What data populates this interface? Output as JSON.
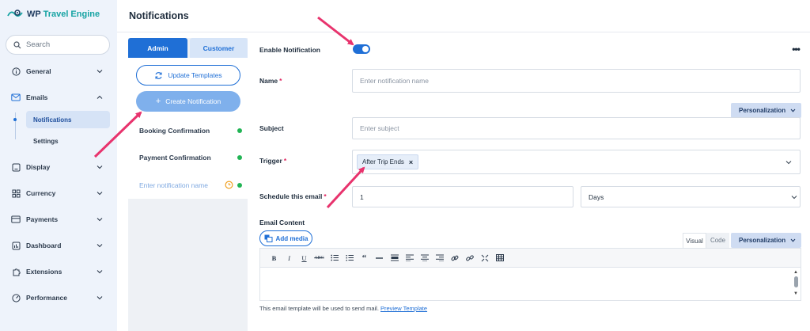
{
  "app": {
    "logo_main": "WP ",
    "logo_accent": "Travel Engine"
  },
  "search": {
    "placeholder": "Search"
  },
  "sidebar": {
    "items": [
      {
        "label": "General",
        "icon": "info-circle-icon"
      },
      {
        "label": "Emails",
        "icon": "envelope-icon"
      },
      {
        "label": "Display",
        "icon": "display-icon"
      },
      {
        "label": "Currency",
        "icon": "grid-icon"
      },
      {
        "label": "Payments",
        "icon": "card-icon"
      },
      {
        "label": "Dashboard",
        "icon": "dashboard-icon"
      },
      {
        "label": "Extensions",
        "icon": "puzzle-icon"
      },
      {
        "label": "Performance",
        "icon": "gauge-icon"
      }
    ],
    "sub_items": [
      {
        "label": "Notifications",
        "active": true
      },
      {
        "label": "Settings",
        "active": false
      }
    ]
  },
  "header": {
    "title": "Notifications"
  },
  "mid": {
    "tabs": [
      {
        "label": "Admin",
        "active": true
      },
      {
        "label": "Customer",
        "active": false
      }
    ],
    "update_label": "Update Templates",
    "create_label": "Create Notification",
    "list": [
      {
        "label": "Booking Confirmation",
        "status": "active"
      },
      {
        "label": "Payment Confirmation",
        "status": "active"
      },
      {
        "label": "Enter notification name",
        "status": "draft"
      }
    ]
  },
  "form": {
    "enable_label": "Enable Notification",
    "enable_value": true,
    "name_label": "Name",
    "name_placeholder": "Enter notification name",
    "personalization_label": "Personalization",
    "subject_label": "Subject",
    "subject_placeholder": "Enter subject",
    "trigger_label": "Trigger",
    "trigger_chip": "After Trip Ends",
    "schedule_label": "Schedule this email",
    "schedule_value": "1",
    "schedule_unit": "Days",
    "content_label": "Email Content",
    "add_media_label": "Add media",
    "editor_tabs": {
      "visual": "Visual",
      "code": "Code"
    },
    "footnote": "This email template will be used to send mail. ",
    "preview_link": "Preview Template"
  },
  "toolbar": [
    "B",
    "I",
    "U",
    "ABC",
    "bullet-list",
    "numbered-list",
    "quote",
    "hr",
    "align-left-box",
    "align-left",
    "align-center",
    "align-right",
    "link",
    "unlink",
    "fullscreen",
    "table"
  ],
  "colors": {
    "primary": "#1f6fd6",
    "accent": "#16a3a3",
    "sidebar_bg": "#eef3fb",
    "status_green": "#22b455",
    "annotation": "#e8336d"
  }
}
